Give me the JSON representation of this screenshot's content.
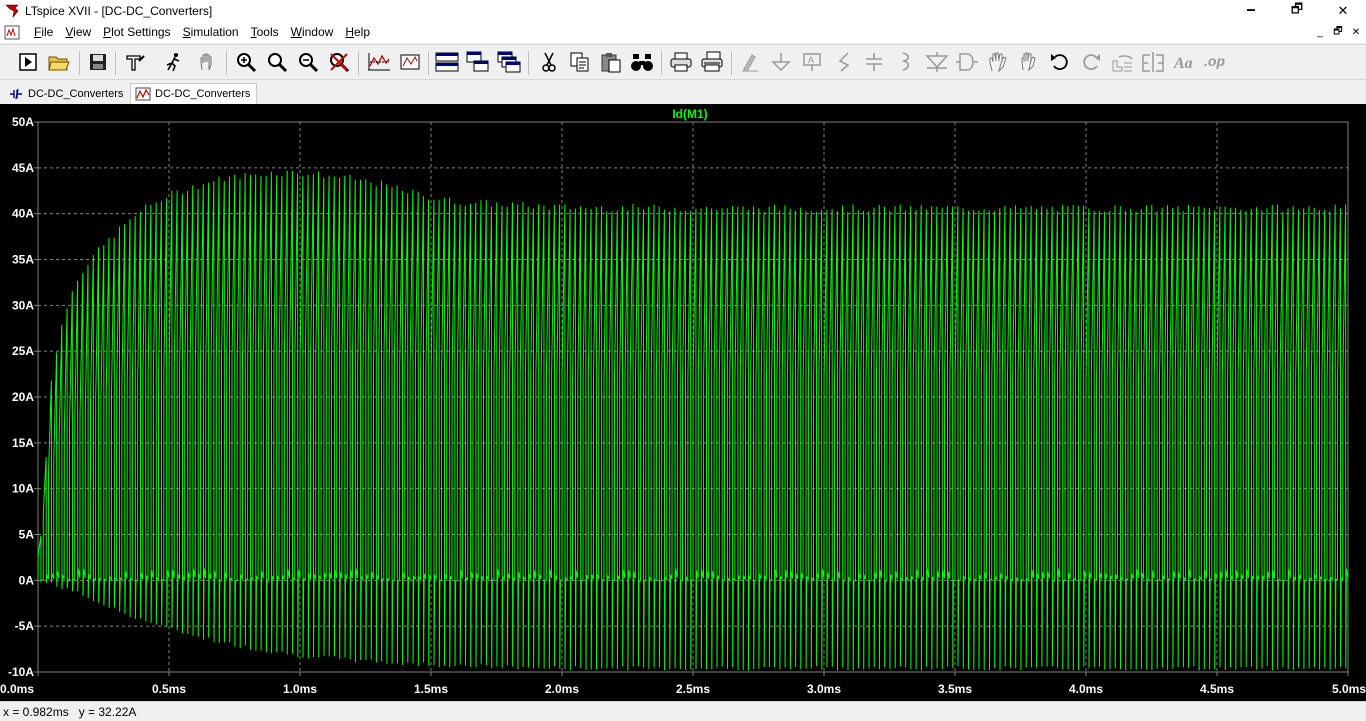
{
  "window": {
    "title": "LTspice XVII - [DC-DC_Converters]",
    "minimize": "🗕",
    "maximize": "🗗",
    "close": "✕"
  },
  "menu": {
    "items": [
      "File",
      "View",
      "Plot Settings",
      "Simulation",
      "Tools",
      "Window",
      "Help"
    ],
    "mdi_minimize": "_",
    "mdi_restore": "🗗",
    "mdi_close": "✕"
  },
  "toolbar": {
    "buttons": [
      "run-icon",
      "open-icon",
      "save-icon",
      "control-panel-icon",
      "run-stop-icon",
      "pan-icon",
      "zoom-in-icon",
      "zoom-area-icon",
      "zoom-out-icon",
      "zoom-cancel-icon",
      "autoscale-icon",
      "zoom-fit-icon",
      "tile-horizontal-icon",
      "tile-vertical-icon",
      "cascade-icon",
      "cut-icon",
      "copy-icon",
      "paste-icon",
      "find-icon",
      "print-icon",
      "print-preview-icon",
      "wire-icon",
      "ground-icon",
      "label-icon",
      "resistor-icon",
      "capacitor-icon",
      "inductor-icon",
      "diode-icon",
      "component-icon",
      "move-icon",
      "drag-icon",
      "undo-icon",
      "redo-icon",
      "rotate-icon",
      "mirror-icon",
      "text-icon",
      "spice-directive-icon"
    ]
  },
  "tabs": [
    {
      "label": "DC-DC_Converters",
      "kind": "schematic",
      "active": false
    },
    {
      "label": "DC-DC_Converters",
      "kind": "waveform",
      "active": true
    }
  ],
  "chart_data": {
    "type": "line",
    "title": "",
    "trace_name": "Id(M1)",
    "trace_color": "#00ff00",
    "background_color": "#000000",
    "grid": true,
    "xlabel": "",
    "ylabel": "",
    "xlim": [
      0.0,
      5.0
    ],
    "ylim": [
      -10,
      50
    ],
    "x_unit": "ms",
    "y_unit": "A",
    "x_ticks": [
      "0.0ms",
      "0.5ms",
      "1.0ms",
      "1.5ms",
      "2.0ms",
      "2.5ms",
      "3.0ms",
      "3.5ms",
      "4.0ms",
      "4.5ms",
      "5.0ms"
    ],
    "y_ticks": [
      "50A",
      "45A",
      "40A",
      "35A",
      "30A",
      "25A",
      "20A",
      "15A",
      "10A",
      "5A",
      "0A",
      "-5A",
      "-10A"
    ],
    "switching_cycles": 250,
    "peak_envelope": {
      "x": [
        0.0,
        0.05,
        0.1,
        0.15,
        0.2,
        0.3,
        0.4,
        0.5,
        0.6,
        0.7,
        0.8,
        0.9,
        1.0,
        1.1,
        1.2,
        1.3,
        1.4,
        1.5,
        1.6,
        1.8,
        2.0,
        2.5,
        3.0,
        3.5,
        4.0,
        4.5,
        5.0
      ],
      "y": [
        0.0,
        22.0,
        29.0,
        33.0,
        35.0,
        38.0,
        40.5,
        42.0,
        43.0,
        43.8,
        44.2,
        44.5,
        44.5,
        44.2,
        43.8,
        43.3,
        42.5,
        41.8,
        41.3,
        41.0,
        40.7,
        40.6,
        40.6,
        40.6,
        40.6,
        40.6,
        40.6
      ]
    },
    "valley_envelope": {
      "x": [
        0.0,
        0.1,
        0.2,
        0.3,
        0.4,
        0.5,
        0.6,
        0.7,
        0.8,
        0.9,
        1.0,
        1.2,
        1.4,
        1.6,
        1.8,
        2.0,
        2.5,
        3.0,
        3.5,
        4.0,
        4.5,
        5.0
      ],
      "y": [
        0.0,
        -0.8,
        -2.0,
        -3.3,
        -4.3,
        -5.3,
        -6.0,
        -6.8,
        -7.3,
        -7.8,
        -8.2,
        -8.7,
        -9.1,
        -9.3,
        -9.5,
        -9.6,
        -9.6,
        -9.6,
        -9.6,
        -9.6,
        -9.6,
        -9.6
      ]
    },
    "off_state_level": 0.6
  },
  "status": {
    "x_readout": "x = 0.982ms",
    "y_readout": "y = 32.22A"
  }
}
